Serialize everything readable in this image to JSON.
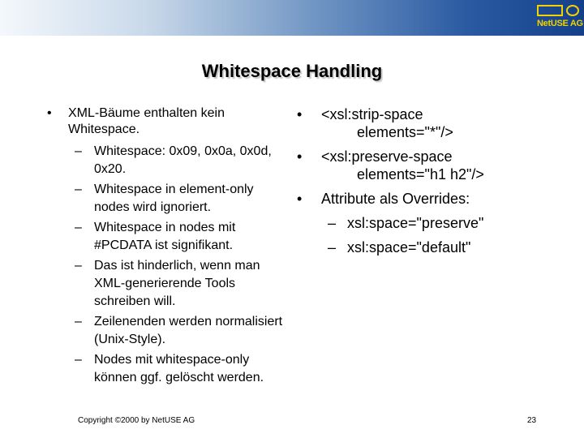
{
  "header": {
    "logo_text": "NetUSE AG"
  },
  "slide": {
    "title": "Whitespace Handling"
  },
  "left": {
    "bullet": "XML-Bäume enthalten kein Whitespace.",
    "subitems": [
      "Whitespace: 0x09, 0x0a, 0x0d, 0x20.",
      "Whitespace in element-only nodes wird ignoriert.",
      "Whitespace in nodes mit #PCDATA ist signifikant.",
      "Das ist hinderlich, wenn man XML-generierende Tools schreiben will.",
      "Zeilenenden werden normalisiert (Unix-Style).",
      "Nodes mit whitespace-only können ggf. gelöscht werden."
    ]
  },
  "right": {
    "items": [
      {
        "line1": "<xsl:strip-space",
        "line2": "elements=\"*\"/>"
      },
      {
        "line1": "<xsl:preserve-space",
        "line2": "elements=\"h1 h2\"/>"
      }
    ],
    "attr_bullet": "Attribute als Overrides:",
    "subitems": [
      "xsl:space=\"preserve\"",
      "xsl:space=\"default\""
    ]
  },
  "footer": {
    "copyright": "Copyright ©2000 by NetUSE AG",
    "page_number": "23"
  }
}
